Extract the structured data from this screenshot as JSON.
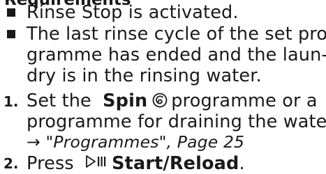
{
  "heading": "Requirements",
  "requirements": [
    {
      "lines": [
        "Rinse Stop is activated."
      ]
    },
    {
      "lines": [
        "The last rinse cycle of the set pro-",
        "gramme has ended and the laun-",
        "dry is in the rinsing water."
      ]
    }
  ],
  "steps": [
    {
      "number": "1.",
      "pre": "Set the",
      "bold": "Spin",
      "post": "programme or a",
      "line2": "programme for draining the water.",
      "reference": "→ \"Programmes\", Page 25",
      "icon": "spin-icon"
    },
    {
      "number": "2.",
      "pre": "Press",
      "bold": "Start/Reload",
      "post": ".",
      "icon": "start-pause-icon"
    }
  ]
}
